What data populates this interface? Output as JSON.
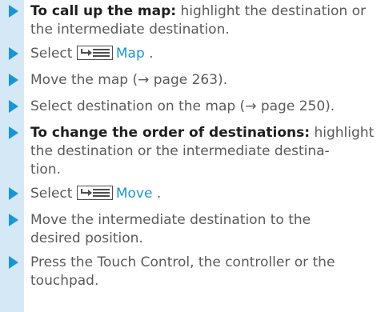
{
  "steps": [
    {
      "lead": "To call up the map:",
      "lines": [
        " highlight the destination or",
        "the intermediate destination."
      ]
    },
    {
      "prefix": "Select ",
      "icon": "menu-list-icon",
      "menu_label": "Map",
      "suffix": " ."
    },
    {
      "lines": [
        "Move the map (→ page 263)."
      ]
    },
    {
      "lines": [
        "Select destination on the map (→ page 250)."
      ]
    },
    {
      "lead": "To change the order of destinations:",
      "lines": [
        " highlight",
        "the destination or the intermediate destina-",
        "tion."
      ]
    },
    {
      "prefix": "Select ",
      "icon": "menu-list-icon",
      "menu_label": "Move",
      "suffix": " ."
    },
    {
      "lines": [
        "Move the intermediate destination to the",
        "desired position."
      ]
    },
    {
      "lines": [
        "Press the Touch Control, the controller or the",
        "touchpad."
      ]
    }
  ],
  "colors": {
    "arrow": "#1a96d6",
    "gutter": "#d4e9f5",
    "menu_label": "#1a96d6",
    "body_text": "#5a5a5a",
    "bold_text": "#1e1e1e"
  }
}
